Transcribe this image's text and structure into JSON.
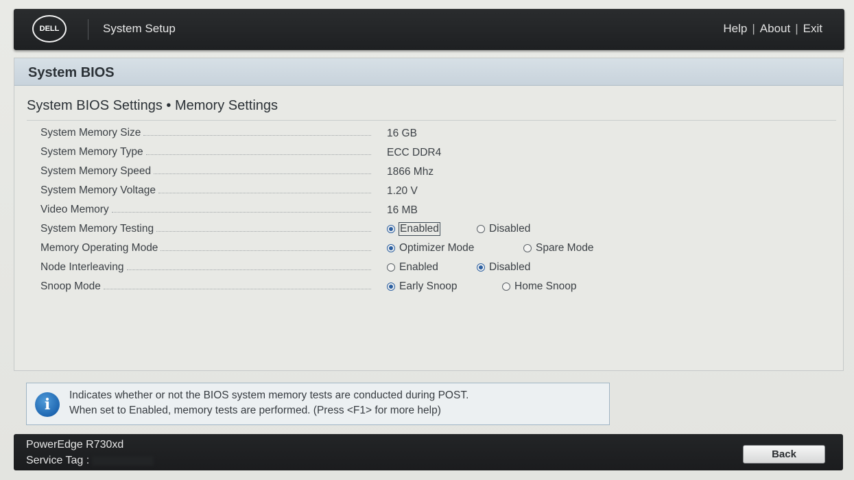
{
  "topbar": {
    "logo_text": "DELL",
    "app_title": "System Setup",
    "links": [
      "Help",
      "About",
      "Exit"
    ],
    "separator": "|"
  },
  "panel": {
    "header_title": "System BIOS",
    "page_heading": "System BIOS Settings • Memory Settings"
  },
  "settings": [
    {
      "label": "System Memory Size",
      "value": "16 GB"
    },
    {
      "label": "System Memory Type",
      "value": "ECC DDR4"
    },
    {
      "label": "System Memory Speed",
      "value": "1866 Mhz"
    },
    {
      "label": "System Memory Voltage",
      "value": "1.20 V"
    },
    {
      "label": "Video Memory",
      "value": "16 MB"
    },
    {
      "label": "System Memory Testing",
      "options": [
        "Enabled",
        "Disabled"
      ],
      "selected": "Enabled"
    },
    {
      "label": "Memory Operating Mode",
      "options": [
        "Optimizer Mode",
        "Spare Mode"
      ],
      "selected": "Optimizer Mode"
    },
    {
      "label": "Node Interleaving",
      "options": [
        "Enabled",
        "Disabled"
      ],
      "selected": "Disabled"
    },
    {
      "label": "Snoop Mode",
      "options": [
        "Early Snoop",
        "Home Snoop"
      ],
      "selected": "Early Snoop"
    }
  ],
  "help": {
    "icon": "info-icon",
    "line1": "Indicates whether or not the BIOS system memory tests are conducted during POST.",
    "line2": "When set to Enabled, memory tests are performed. (Press <F1> for more help)"
  },
  "footer": {
    "model": "PowerEdge R730xd",
    "service_tag_label": "Service Tag :",
    "back_label": "Back"
  },
  "colors": {
    "topbar": "#1e2022",
    "panel_header": "#c8d3dc",
    "radio_selected": "#2c5fa0",
    "info_icon": "#1f67b1"
  }
}
